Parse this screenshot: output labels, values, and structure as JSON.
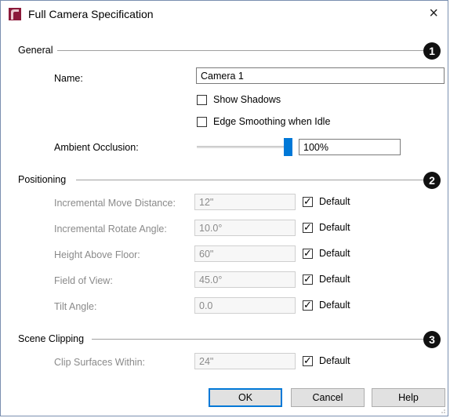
{
  "window": {
    "title": "Full Camera Specification",
    "close_glyph": "×",
    "app_icon": "chief-architect-logo-icon"
  },
  "general": {
    "label": "General",
    "badge": "1",
    "name_label": "Name:",
    "name_value": "Camera 1",
    "show_shadows_label": "Show Shadows",
    "show_shadows_checked": false,
    "edge_smoothing_label": "Edge Smoothing when Idle",
    "edge_smoothing_checked": false,
    "ambient_occlusion_label": "Ambient Occlusion:",
    "ambient_occlusion_value": "100%",
    "ambient_occlusion_level": 1.0
  },
  "positioning": {
    "label": "Positioning",
    "badge": "2",
    "rows": [
      {
        "label": "Incremental Move Distance:",
        "value": "12\"",
        "default_label": "Default",
        "default_checked": true
      },
      {
        "label": "Incremental Rotate Angle:",
        "value": "10.0°",
        "default_label": "Default",
        "default_checked": true
      },
      {
        "label": "Height Above Floor:",
        "value": "60\"",
        "default_label": "Default",
        "default_checked": true
      },
      {
        "label": "Field of View:",
        "value": "45.0°",
        "default_label": "Default",
        "default_checked": true
      },
      {
        "label": "Tilt Angle:",
        "value": "0.0",
        "default_label": "Default",
        "default_checked": true
      }
    ]
  },
  "scene_clipping": {
    "label": "Scene Clipping",
    "badge": "3",
    "clip_label": "Clip Surfaces Within:",
    "clip_value": "24\"",
    "default_label": "Default",
    "default_checked": true
  },
  "buttons": {
    "ok": "OK",
    "cancel": "Cancel",
    "help": "Help"
  },
  "colors": {
    "accent": "#0078d7",
    "icon_maroon": "#8b1a3a",
    "disabled_text": "#8a8a8a"
  }
}
